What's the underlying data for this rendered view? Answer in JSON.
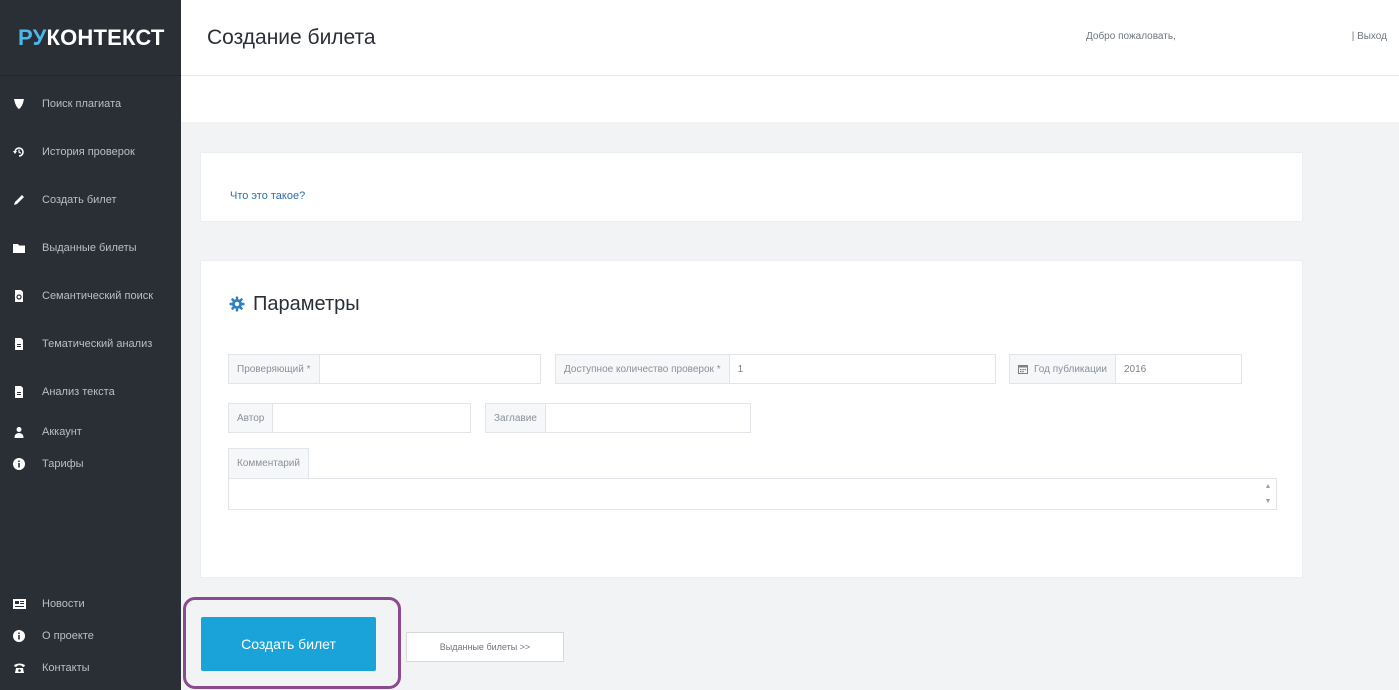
{
  "sidebar": {
    "logo_ru": "РУ",
    "logo_ctx": "КОНТЕКСТ",
    "items": [
      {
        "label": "Поиск плагиата",
        "icon": "shield-icon"
      },
      {
        "label": "История проверок",
        "icon": "history-icon"
      },
      {
        "label": "Создать билет",
        "icon": "pen-icon"
      },
      {
        "label": "Выданные билеты",
        "icon": "folder-icon"
      },
      {
        "label": "Семантический поиск",
        "icon": "document-search-icon"
      },
      {
        "label": "Тематический анализ",
        "icon": "document-icon"
      },
      {
        "label": "Анализ текста",
        "icon": "document-icon"
      },
      {
        "label": "Аккаунт",
        "icon": "user-icon"
      },
      {
        "label": "Тарифы",
        "icon": "info-icon"
      }
    ],
    "bottom_items": [
      {
        "label": "Новости",
        "icon": "news-icon"
      },
      {
        "label": "О проекте",
        "icon": "info-icon"
      },
      {
        "label": "Контакты",
        "icon": "phone-icon"
      }
    ]
  },
  "header": {
    "title": "Создание билета",
    "welcome": "Добро пожаловать,",
    "logout": "| Выход"
  },
  "help": {
    "link": "Что это такое?"
  },
  "params": {
    "title": "Параметры",
    "checker_label": "Проверяющий *",
    "checker_value": "",
    "checks_label": "Доступное количество проверок *",
    "checks_value": "1",
    "year_label": "Год публикации",
    "year_value": "2016",
    "author_label": "Автор",
    "author_value": "",
    "title_label": "Заглавие",
    "title_value": "",
    "comment_label": "Комментарий",
    "comment_value": ""
  },
  "buttons": {
    "create": "Создать билет",
    "issued": "Выданные билеты >>"
  },
  "colors": {
    "sidebar_bg": "#2a2f36",
    "accent": "#1aa3d9",
    "highlight": "#8a4a8e",
    "logo_accent": "#4ab8e8"
  }
}
